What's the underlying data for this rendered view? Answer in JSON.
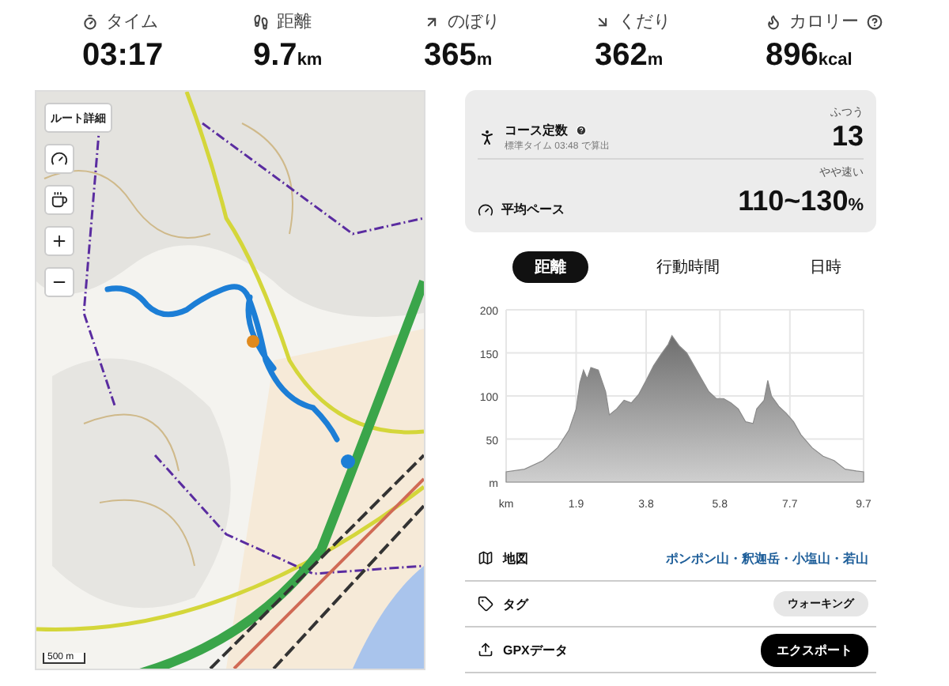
{
  "stats": [
    {
      "label": "タイム",
      "value": "03:17"
    },
    {
      "label": "距離",
      "value": "9.7",
      "unit": "km"
    },
    {
      "label": "のぼり",
      "value": "365",
      "unit": "m"
    },
    {
      "label": "くだり",
      "value": "362",
      "unit": "m"
    },
    {
      "label": "カロリー",
      "value": "896",
      "unit": "kcal"
    }
  ],
  "map": {
    "route_button": "ルート詳細",
    "scale": "500 m"
  },
  "course": {
    "title": "コース定数",
    "subtitle": "標準タイム 03:48 で算出",
    "rating": "ふつう",
    "value": "13",
    "pace_label": "平均ペース",
    "pace_rating": "やや速い",
    "pace_value": "110~130",
    "pace_unit": "%"
  },
  "tabs": [
    {
      "label": "距離",
      "selected": true
    },
    {
      "label": "行動時間",
      "selected": false
    },
    {
      "label": "日時",
      "selected": false
    }
  ],
  "chart_data": {
    "type": "area",
    "x": [
      0,
      0.5,
      1.0,
      1.4,
      1.7,
      1.9,
      2.0,
      2.1,
      2.2,
      2.3,
      2.5,
      2.7,
      2.8,
      3.0,
      3.2,
      3.4,
      3.6,
      3.8,
      4.0,
      4.2,
      4.4,
      4.5,
      4.7,
      4.9,
      5.1,
      5.3,
      5.5,
      5.7,
      5.9,
      6.1,
      6.3,
      6.5,
      6.7,
      6.8,
      7.0,
      7.1,
      7.2,
      7.4,
      7.6,
      7.8,
      8.0,
      8.3,
      8.6,
      8.9,
      9.2,
      9.5,
      9.7
    ],
    "grid": true,
    "series": [
      {
        "color": "#8a8a8a",
        "values": [
          12,
          15,
          25,
          40,
          60,
          85,
          115,
          130,
          120,
          133,
          130,
          105,
          78,
          85,
          95,
          92,
          102,
          118,
          135,
          148,
          160,
          170,
          158,
          150,
          135,
          120,
          105,
          97,
          97,
          92,
          85,
          70,
          68,
          85,
          95,
          118,
          100,
          88,
          80,
          70,
          55,
          40,
          30,
          25,
          15,
          13,
          12
        ]
      }
    ],
    "xlim": [
      0,
      9.7
    ],
    "ylim": [
      0,
      200
    ],
    "xticks": [
      {
        "value": 0,
        "label": "km"
      },
      1.9,
      3.8,
      5.8,
      7.7,
      9.7
    ],
    "yticks": [
      {
        "value": 0,
        "label": "m"
      },
      50,
      100,
      150,
      200
    ]
  },
  "rows": [
    {
      "kind": "map",
      "label": "地図",
      "value": "ポンポン山・釈迦岳・小塩山・若山"
    },
    {
      "kind": "tag",
      "label": "タグ",
      "value": "ウォーキング"
    },
    {
      "kind": "export",
      "label": "GPXデータ",
      "value": "エクスポート"
    }
  ]
}
